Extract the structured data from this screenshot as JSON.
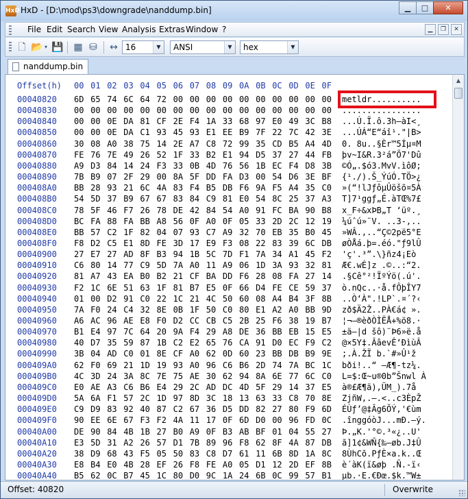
{
  "window": {
    "title": "HxD - [D:\\mod\\ps3\\downgrade\\nanddump.bin]",
    "app_icon": "HxD"
  },
  "menu": [
    "File",
    "Edit",
    "Search",
    "View",
    "Analysis",
    "Extras",
    "Window",
    "?"
  ],
  "toolbar": {
    "bytes_per_row": "16",
    "charset": "ANSI",
    "offset_base": "hex",
    "icons": [
      "new-file-icon",
      "open-folder-icon",
      "save-disk-icon",
      "ram-editor-icon",
      "disk-editor-icon",
      "bytes-per-row-icon"
    ]
  },
  "tab": {
    "label": "nanddump.bin"
  },
  "editor": {
    "offset_header": "Offset(h)",
    "columns": [
      "00",
      "01",
      "02",
      "03",
      "04",
      "05",
      "06",
      "07",
      "08",
      "09",
      "0A",
      "0B",
      "0C",
      "0D",
      "0E",
      "0F"
    ],
    "rows": [
      {
        "off": "00040820",
        "hex": "6D 65 74 6C 64 72 00 00 00 00 00 00 00 00 00 00",
        "txt": "metldr.........."
      },
      {
        "off": "00040830",
        "hex": "00 00 00 00 00 00 00 00 00 00 00 00 00 00 00 00",
        "txt": "................"
      },
      {
        "off": "00040840",
        "hex": "00 00 0E DA 81 CF 2E F4 1A 33 68 97 E0 49 3C B8",
        "txt": "...Ú.Ï.ô.3h—àI<¸"
      },
      {
        "off": "00040850",
        "hex": "00 00 0E DA C1 93 45 93 E1 EE B9 7F 22 7C 42 3E",
        "txt": "...ÚÁ“E“áî¹.\"|B>"
      },
      {
        "off": "00040860",
        "hex": "30 08 A0 38 75 14 2E A7 C8 72 99 35 CD B5 A4 4D",
        "txt": "0. 8u..§Èr™5Íµ¤M"
      },
      {
        "off": "00040870",
        "hex": "FE 76 7E 49 26 52 1F 33 B2 E1 94 D5 37 27 44 FB",
        "txt": "þv~I&R.3²á”Õ7'Dû"
      },
      {
        "off": "00040880",
        "hex": "A9 D3 84 14 24 F3 33 0B 4D 76 56 1B EC F4 D8 3B",
        "txt": "©Ó„.$ó3.MvV.ìôØ;"
      },
      {
        "off": "00040890",
        "hex": "7B B9 07 2F 29 00 8A 5F DD FA D3 00 54 D6 3E BF",
        "txt": "{¹./).Š_ÝúÓ.TÖ>¿"
      },
      {
        "off": "000408A0",
        "hex": "BB 28 93 21 6C 4A 83 F4 B5 DB F6 9A F5 A4 35 C0",
        "txt": "»(“!lJƒôµÛöšõ¤5À"
      },
      {
        "off": "000408B0",
        "hex": "54 5D 37 B9 67 67 83 84 C9 81 E0 54 8C 25 37 A3",
        "txt": "T]7¹ggƒ„É.àTŒ%7£"
      },
      {
        "off": "000408C0",
        "hex": "78 5F 46 F7 26 78 DE 42 84 54 A0 91 FC BA 90 B8",
        "txt": "x_F÷&xÞB„T ‘üº.¸"
      },
      {
        "off": "000408D0",
        "hex": "BC FA 88 FA BB A8 56 0F A0 0F 05 33 2D 2C 12 19",
        "txt": "¼úˆú»¨V. ..3-,.."
      },
      {
        "off": "000408E0",
        "hex": "BB 57 C2 1F 82 04 07 93 C7 A9 32 70 EB 35 B0 45",
        "txt": "»WÂ.‚..“Ç©2pë5°E"
      },
      {
        "off": "000408F0",
        "hex": "F8 D2 C5 E1 8D FE 3D 17 E9 F3 08 22 83 39 6C DB",
        "txt": "øÒÅá.þ=.éó.\"ƒ9lÛ"
      },
      {
        "off": "00040900",
        "hex": "27 E7 27 AD 8F B3 94 1B 5C 7D F1 7A 34 A1 45 F2",
        "txt": "'ç'­.³”.\\}ñz4¡Eò"
      },
      {
        "off": "00040910",
        "hex": "C6 80 14 77 C9 5D 7A A0 11 A9 06 1D 3A 93 32 81",
        "txt": "Æ€.wÉ]z .©..:“2."
      },
      {
        "off": "00040920",
        "hex": "81 A7 43 EA B0 B2 21 CF BA DD F6 28 08 FA 27 14",
        "txt": ".§Cê°²!ÏºÝö(.ú'."
      },
      {
        "off": "00040930",
        "hex": "F2 1C 6E 51 63 1F 81 B7 E5 0F 66 D4 FE CE 59 37",
        "txt": "ò.nQc..·å.fÔþÎY7"
      },
      {
        "off": "00040940",
        "hex": "01 00 D2 91 C0 22 1C 21 4C 50 60 08 A4 B4 3F 8B",
        "txt": "..Ò‘À\".!LP`.¤´?‹"
      },
      {
        "off": "00040950",
        "hex": "7A F0 24 C4 32 8E 0B 1F 50 C0 80 E1 A2 A0 BB 9D",
        "txt": "zð$Ä2Ž..PÀ€á¢ »."
      },
      {
        "off": "00040960",
        "hex": "A6 AC 96 AE E8 F0 D2 CC CB C5 2B 25 F6 38 19 B7",
        "txt": "¦¬–®èðÒÌËÅ+%ö8.·"
      },
      {
        "off": "00040970",
        "hex": "B1 E4 97 7C 64 20 9A F4 29 A8 DE 36 BB EB 15 E5",
        "txt": "±ä—|d šô)¨Þ6»ë.å"
      },
      {
        "off": "00040980",
        "hex": "40 D7 35 59 87 1B C2 E2 65 76 CA 91 D0 EC F9 C2",
        "txt": "@×5Y‡.ÂâevÊ‘ÐìùÂ"
      },
      {
        "off": "00040990",
        "hex": "3B 04 AD C0 01 8E CF A0 62 0D 60 23 BB DB B9 9E",
        "txt": ";.­À.ŽÏ b.`#»Û¹ž"
      },
      {
        "off": "000409A0",
        "hex": "62 F0 69 21 1D 19 93 A0 96 C6 B6 2D 74 7A BC 1C",
        "txt": "bði!..“ –Æ¶-tz¼."
      },
      {
        "off": "000409B0",
        "hex": "4C 3D 24 3A 8C 7E 75 AE 30 62 94 8A 6E 77 6C C0",
        "txt": "L=$:Œ~u®0b”Šnwl À"
      },
      {
        "off": "000409C0",
        "hex": "E0 AE A3 C6 B6 E4 29 2C AD DC 4D 5F 29 14 37 E5",
        "txt": "à®£Æ¶ä),­ÜM_).7å"
      },
      {
        "off": "000409D0",
        "hex": "5A 6A F1 57 2C 1D 97 8D 3C 18 13 63 33 C8 70 8E",
        "txt": "ZjñW,.—.<..c3ÈpŽ"
      },
      {
        "off": "000409E0",
        "hex": "C9 D9 83 92 40 87 C2 67 36 D5 DD 82 27 80 F9 6D",
        "txt": "ÉÙƒ’@‡Âg6ÕÝ‚'€ùm"
      },
      {
        "off": "000409F0",
        "hex": "90 EE 6E 67 F3 F2 4A 11 17 0F 6D D0 00 96 FD 0C",
        "txt": ".înggóòJ...mÐ.–ý."
      },
      {
        "off": "00040A00",
        "hex": "DE 90 84 4B 1B 27 B0 A9 0F B3 AB BF 01 04 55 27",
        "txt": "Þ.„K.'°©.³«¿..U'"
      },
      {
        "off": "00040A10",
        "hex": "E3 5D 31 A2 26 57 D1 7B 89 96 F8 62 8F 4A 87 DB",
        "txt": "ã]1¢&WÑ{‰–øb.J‡Û"
      },
      {
        "off": "00040A20",
        "hex": "38 D9 68 43 F5 05 50 83 C8 D7 61 11 6B 8D 1A 8C",
        "txt": "8ÙhCõ.PƒÈ×a.k..Œ"
      },
      {
        "off": "00040A30",
        "hex": "E8 B4 E0 4B 28 EF 26 F8 FE A0 05 D1 12 2D EF 8B",
        "txt": "è´àK(ï&øþ .Ñ.-ï‹"
      },
      {
        "off": "00040A40",
        "hex": "B5 62 0C B7 45 1C 80 D0 9C 1A 24 6B 0C 99 57 B1",
        "txt": "µb.·E.€Ðœ.$k.™W±"
      }
    ]
  },
  "status": {
    "offset": "Offset: 40820",
    "mode": "Overwrite"
  },
  "colors": {
    "offset_blue": "#1f3aa8",
    "highlight_red": "#e3101a",
    "frame": "#c9dcf2"
  }
}
